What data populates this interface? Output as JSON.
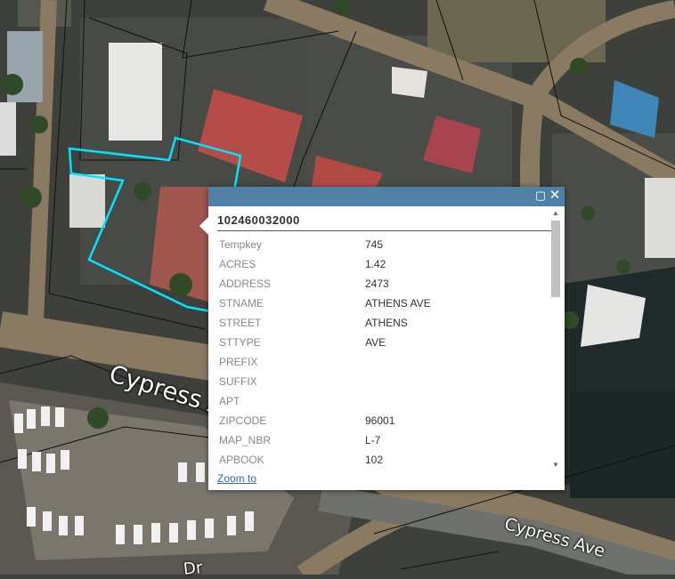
{
  "map": {
    "road_labels": [
      "Cypress A",
      "Cypress Ave",
      "Dr"
    ]
  },
  "popup": {
    "title": "102460032000",
    "maximize_icon": "maximize-icon",
    "close_icon": "close-icon",
    "fields": [
      {
        "key": "Tempkey",
        "value": "745"
      },
      {
        "key": "ACRES",
        "value": "1.42"
      },
      {
        "key": "ADDRESS",
        "value": "2473"
      },
      {
        "key": "STNAME",
        "value": "ATHENS AVE"
      },
      {
        "key": "STREET",
        "value": "ATHENS"
      },
      {
        "key": "STTYPE",
        "value": "AVE"
      },
      {
        "key": "PREFIX",
        "value": ""
      },
      {
        "key": "SUFFIX",
        "value": ""
      },
      {
        "key": "APT",
        "value": ""
      },
      {
        "key": "ZIPCODE",
        "value": "96001"
      },
      {
        "key": "MAP_NBR",
        "value": "L-7"
      },
      {
        "key": "APBOOK",
        "value": "102"
      }
    ],
    "zoom_link": "Zoom to",
    "colors": {
      "titlebar": "#4f81a6",
      "highlight": "#00e5ff"
    }
  }
}
